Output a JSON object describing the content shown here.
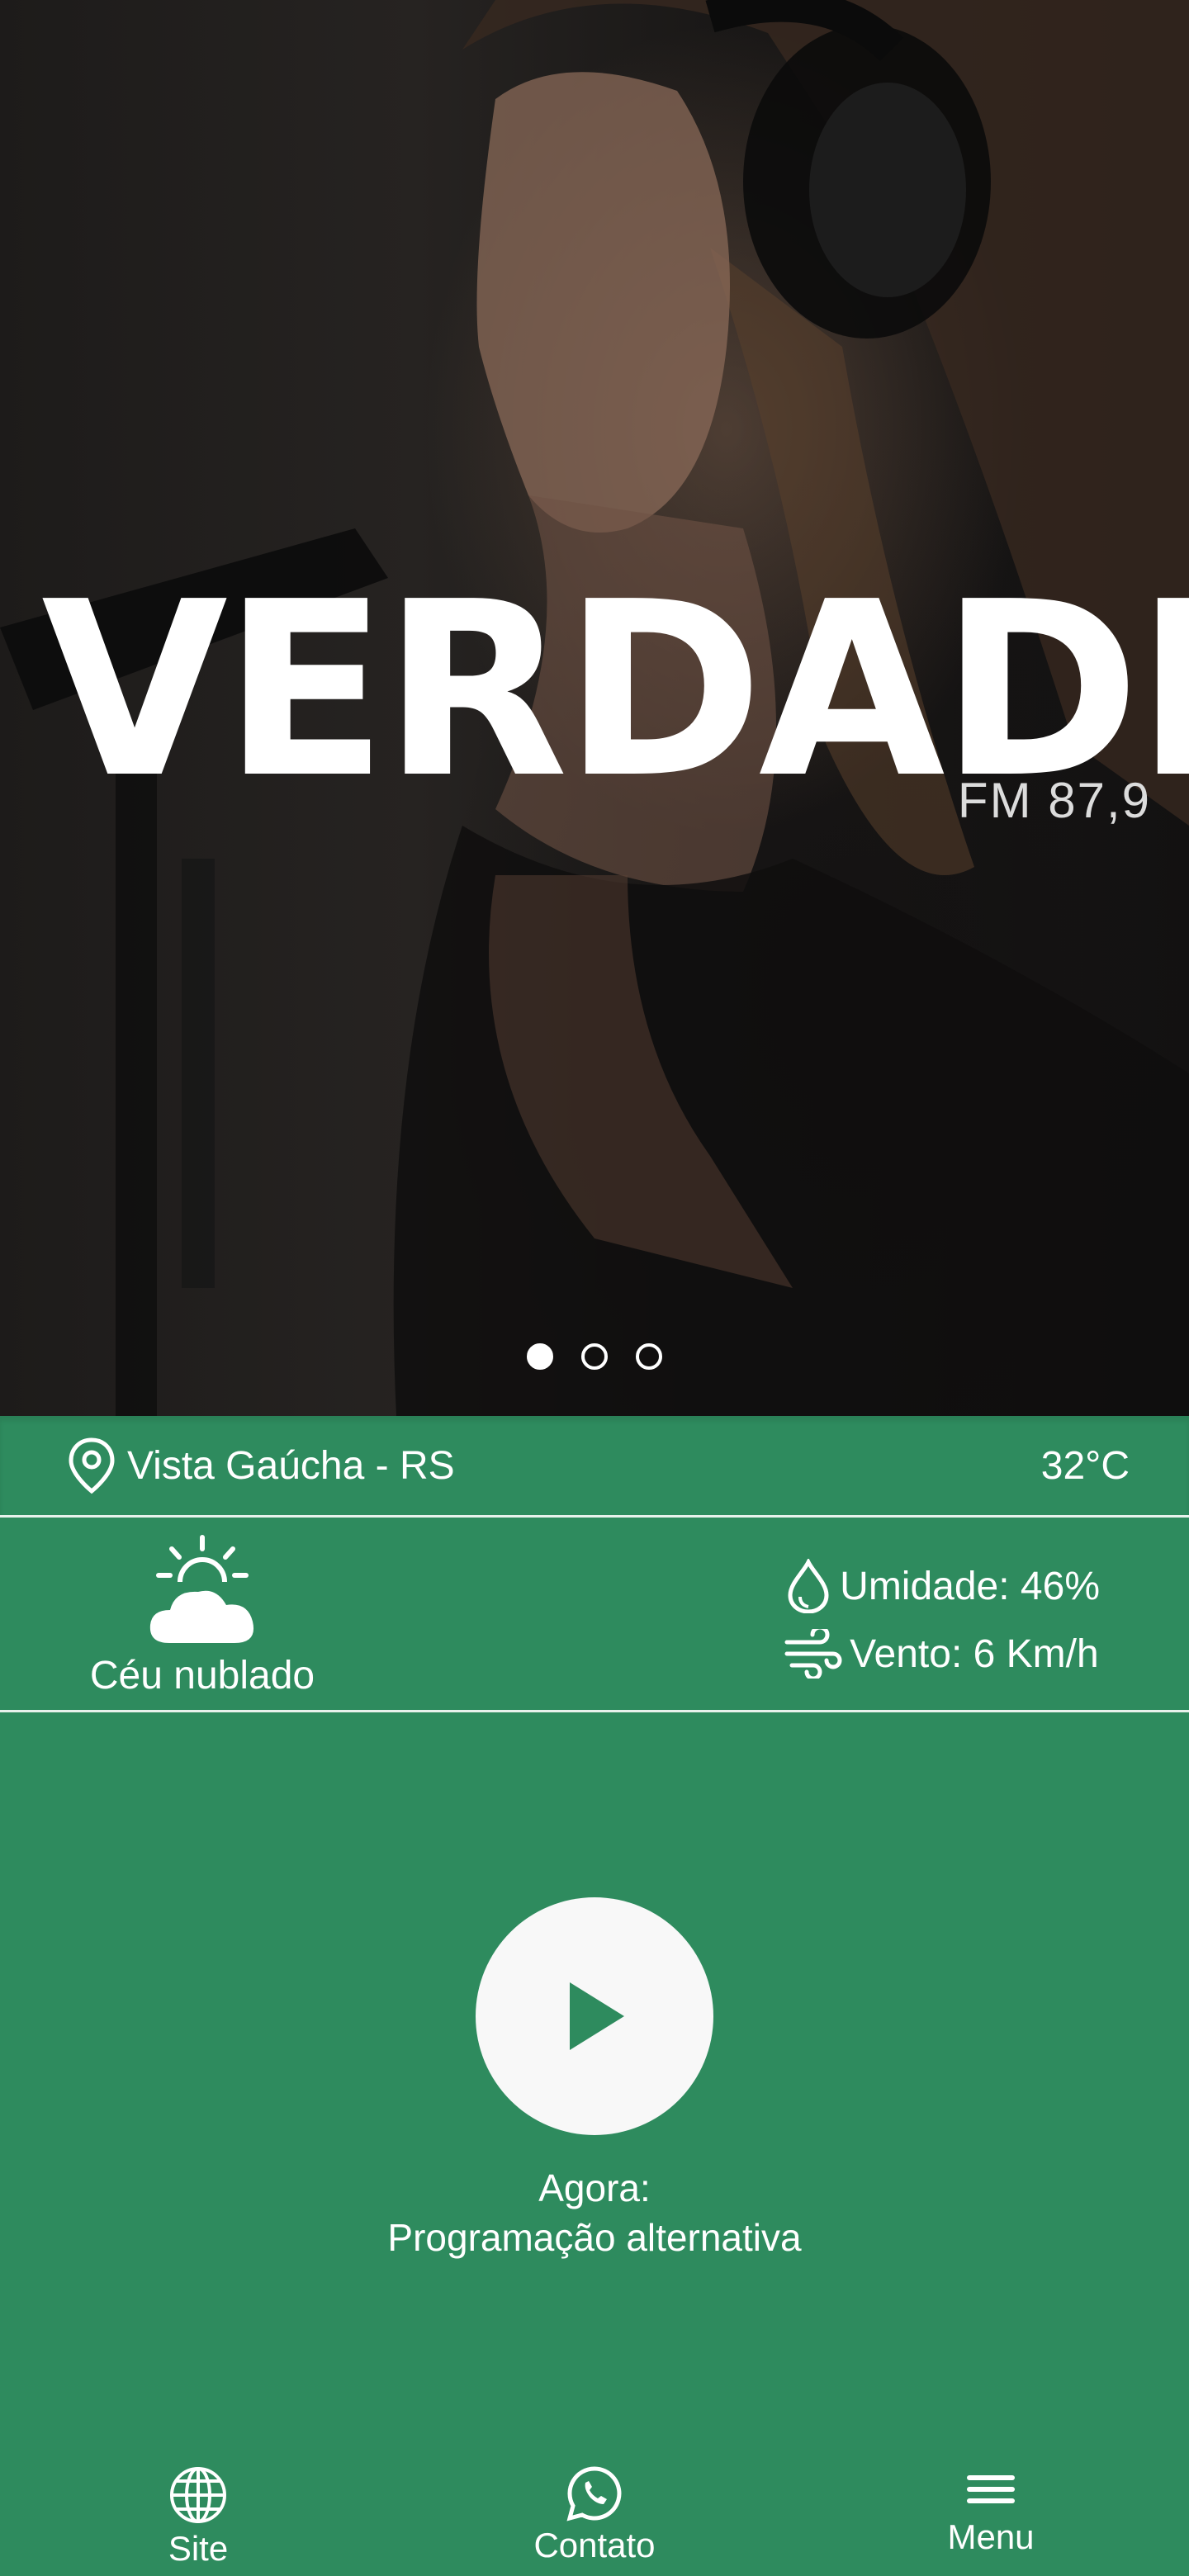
{
  "hero": {
    "logo_text": "VERDADE",
    "logo_subtitle": "FM 87,9",
    "carousel": {
      "count": 3,
      "active_index": 0
    }
  },
  "location": {
    "icon": "map-pin-icon",
    "city": "Vista Gaúcha - RS",
    "temperature": "32°C"
  },
  "weather": {
    "icon": "partly-cloudy-icon",
    "description": "Céu nublado",
    "humidity": "Umidade: 46%",
    "wind": "Vento: 6 Km/h"
  },
  "player": {
    "now_label": "Agora:",
    "now_title": "Programação alternativa"
  },
  "nav": {
    "site": "Site",
    "contato": "Contato",
    "menu": "Menu"
  },
  "colors": {
    "primary_green": "#2e8b5e",
    "white": "#ffffff"
  }
}
